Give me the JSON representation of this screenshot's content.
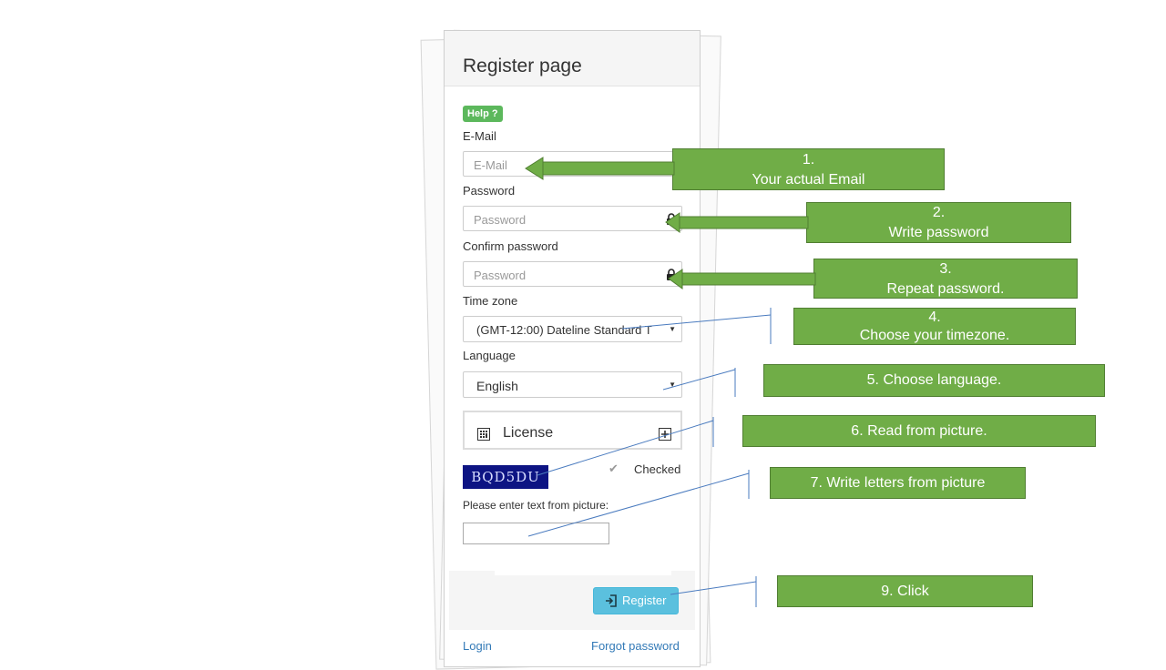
{
  "form": {
    "title": "Register page",
    "help_badge": "Help ?",
    "email": {
      "label": "E-Mail",
      "placeholder": "E-Mail"
    },
    "password": {
      "label": "Password",
      "placeholder": "Password"
    },
    "confirm_password": {
      "label": "Confirm password",
      "placeholder": "Password"
    },
    "timezone": {
      "label": "Time zone",
      "selected": "(GMT-12:00) Dateline Standard T"
    },
    "language": {
      "label": "Language",
      "selected": "English"
    },
    "license": {
      "title": "License"
    },
    "captcha": {
      "text": "BQD5DU",
      "checked_label": "Checked",
      "checked": true,
      "prompt": "Please enter text from picture:"
    },
    "register_button": "Register",
    "links": {
      "login": "Login",
      "forgot": "Forgot password"
    }
  },
  "callouts": [
    {
      "id": "1",
      "line1": "1.",
      "line2": "Your actual Email"
    },
    {
      "id": "2",
      "line1": "2.",
      "line2": "Write password"
    },
    {
      "id": "3",
      "line1": "3.",
      "line2": "Repeat password."
    },
    {
      "id": "4",
      "line1": "4.",
      "line2": "Choose your timezone."
    },
    {
      "id": "5",
      "line1": "5. Choose language."
    },
    {
      "id": "6",
      "line1": "6. Read from picture."
    },
    {
      "id": "7",
      "line1": "7.  Write letters from picture"
    },
    {
      "id": "9",
      "line1": "9. Click"
    }
  ],
  "colors": {
    "callout_green": "#70ad47",
    "help_green": "#5cb85c",
    "register_blue": "#5bc0de",
    "captcha_bg": "#0d1483",
    "link_blue": "#337ab7"
  },
  "icons": {
    "lock": "lock-icon",
    "caret": "caret-down-icon",
    "license": "calculator-icon",
    "expand": "plus-square-icon",
    "register": "sign-in-icon",
    "check": "checkmark-icon"
  }
}
